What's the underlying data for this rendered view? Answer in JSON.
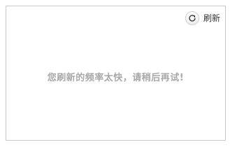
{
  "toolbar": {
    "refresh_label": "刷新",
    "refresh_icon": "refresh-icon"
  },
  "main": {
    "message": "您刷新的频率太快，请稍后再试!"
  },
  "colors": {
    "message_text": "#a8a8a8",
    "border": "#c8c8c8"
  }
}
